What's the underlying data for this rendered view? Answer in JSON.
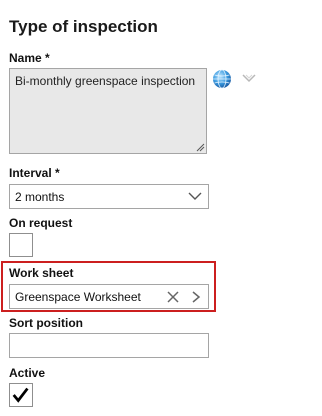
{
  "form": {
    "title": "Type of inspection",
    "name": {
      "label": "Name *",
      "value": "Bi-monthly greenspace inspection"
    },
    "interval": {
      "label": "Interval *",
      "value": "2 months"
    },
    "on_request": {
      "label": "On request",
      "checked": false
    },
    "work_sheet": {
      "label": "Work sheet",
      "value": "Greenspace Worksheet"
    },
    "sort_position": {
      "label": "Sort position",
      "value": ""
    },
    "active": {
      "label": "Active",
      "checked": true
    }
  },
  "icons": {
    "translate": "globe-icon",
    "expand": "chevron-down-icon",
    "dropdown": "chevron-down-icon",
    "clear": "close-icon",
    "navigate": "chevron-right-icon",
    "check": "checkmark-icon"
  },
  "colors": {
    "highlight": "#cc1f1f",
    "disabled_field_bg": "#e8e8e8",
    "border": "#a5a5a5"
  }
}
